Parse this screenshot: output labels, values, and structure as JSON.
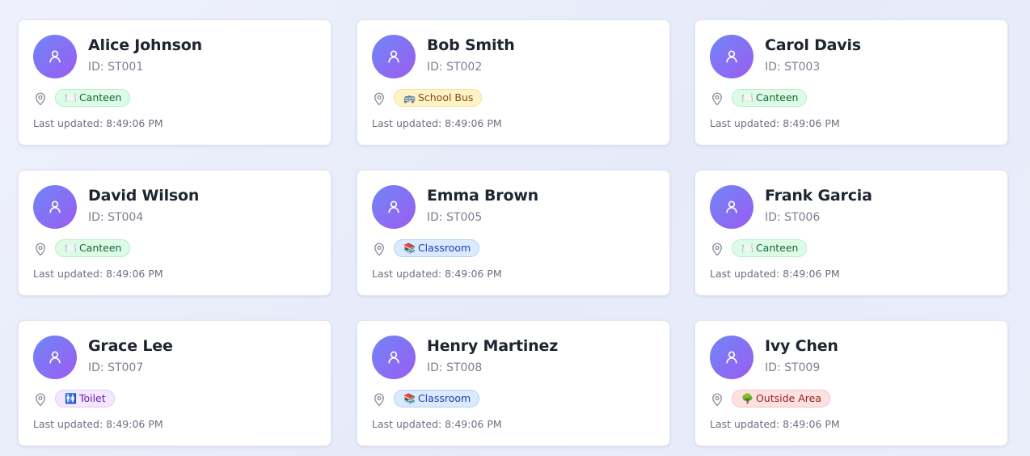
{
  "students": [
    {
      "name": "Alice Johnson",
      "id": "ID: ST001",
      "location": "Canteen",
      "location_icon": "🍽️",
      "location_kind": "canteen",
      "updated": "Last updated: 8:49:06 PM"
    },
    {
      "name": "Bob Smith",
      "id": "ID: ST002",
      "location": "School Bus",
      "location_icon": "🚌",
      "location_kind": "bus",
      "updated": "Last updated: 8:49:06 PM"
    },
    {
      "name": "Carol Davis",
      "id": "ID: ST003",
      "location": "Canteen",
      "location_icon": "🍽️",
      "location_kind": "canteen",
      "updated": "Last updated: 8:49:06 PM"
    },
    {
      "name": "David Wilson",
      "id": "ID: ST004",
      "location": "Canteen",
      "location_icon": "🍽️",
      "location_kind": "canteen",
      "updated": "Last updated: 8:49:06 PM"
    },
    {
      "name": "Emma Brown",
      "id": "ID: ST005",
      "location": "Classroom",
      "location_icon": "📚",
      "location_kind": "classroom",
      "updated": "Last updated: 8:49:06 PM"
    },
    {
      "name": "Frank Garcia",
      "id": "ID: ST006",
      "location": "Canteen",
      "location_icon": "🍽️",
      "location_kind": "canteen",
      "updated": "Last updated: 8:49:06 PM"
    },
    {
      "name": "Grace Lee",
      "id": "ID: ST007",
      "location": "Toilet",
      "location_icon": "🚻",
      "location_kind": "toilet",
      "updated": "Last updated: 8:49:06 PM"
    },
    {
      "name": "Henry Martinez",
      "id": "ID: ST008",
      "location": "Classroom",
      "location_icon": "📚",
      "location_kind": "classroom",
      "updated": "Last updated: 8:49:06 PM"
    },
    {
      "name": "Ivy Chen",
      "id": "ID: ST009",
      "location": "Outside Area",
      "location_icon": "🌳",
      "location_kind": "outside",
      "updated": "Last updated: 8:49:06 PM"
    }
  ],
  "badge_colors": {
    "canteen": {
      "bg": "#dcfce7",
      "border": "#b6ecc8",
      "text": "#166534"
    },
    "bus": {
      "bg": "#fef3c7",
      "border": "#f6e08f",
      "text": "#854d0e"
    },
    "classroom": {
      "bg": "#dbeafe",
      "border": "#b3d0f5",
      "text": "#1e40af"
    },
    "toilet": {
      "bg": "#f3e8ff",
      "border": "#e0c9fb",
      "text": "#6b21a8"
    },
    "outside": {
      "bg": "#fee2e2",
      "border": "#f7c2c2",
      "text": "#991b1b"
    }
  },
  "avatar_gradient": [
    "#6f86f7",
    "#9b5cf1"
  ],
  "icons": {
    "avatar": "user-icon",
    "location": "map-pin-icon"
  }
}
